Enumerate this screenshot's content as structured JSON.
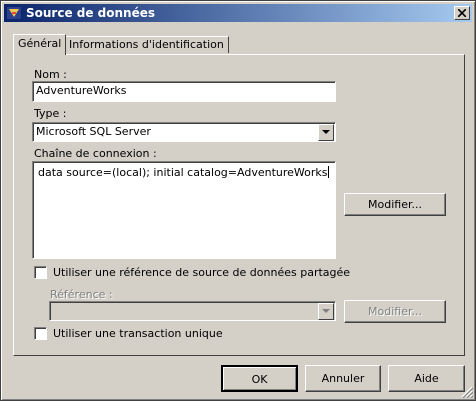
{
  "window": {
    "title": "Source de données"
  },
  "tabs": [
    {
      "label": "Général"
    },
    {
      "label": "Informations d'identification"
    }
  ],
  "general": {
    "name_label": "Nom :",
    "name_value": "AdventureWorks",
    "type_label": "Type :",
    "type_value": "Microsoft SQL Server",
    "connection_label": "Chaîne de connexion :",
    "connection_value": "data source=(local); initial catalog=AdventureWorks",
    "modify_button": "Modifier...",
    "shared_ref_checkbox_label": "Utiliser une référence de source de données partagée",
    "reference_label": "Référence :",
    "reference_value": "",
    "reference_modify_button": "Modifier...",
    "single_transaction_checkbox_label": "Utiliser une transaction unique"
  },
  "footer": {
    "ok_button": "OK",
    "cancel_button": "Annuler",
    "help_button": "Aide"
  },
  "colors": {
    "dialog_bg": "#d4d0c8",
    "titlebar_start": "#0a246a",
    "titlebar_end": "#a6caf0"
  }
}
